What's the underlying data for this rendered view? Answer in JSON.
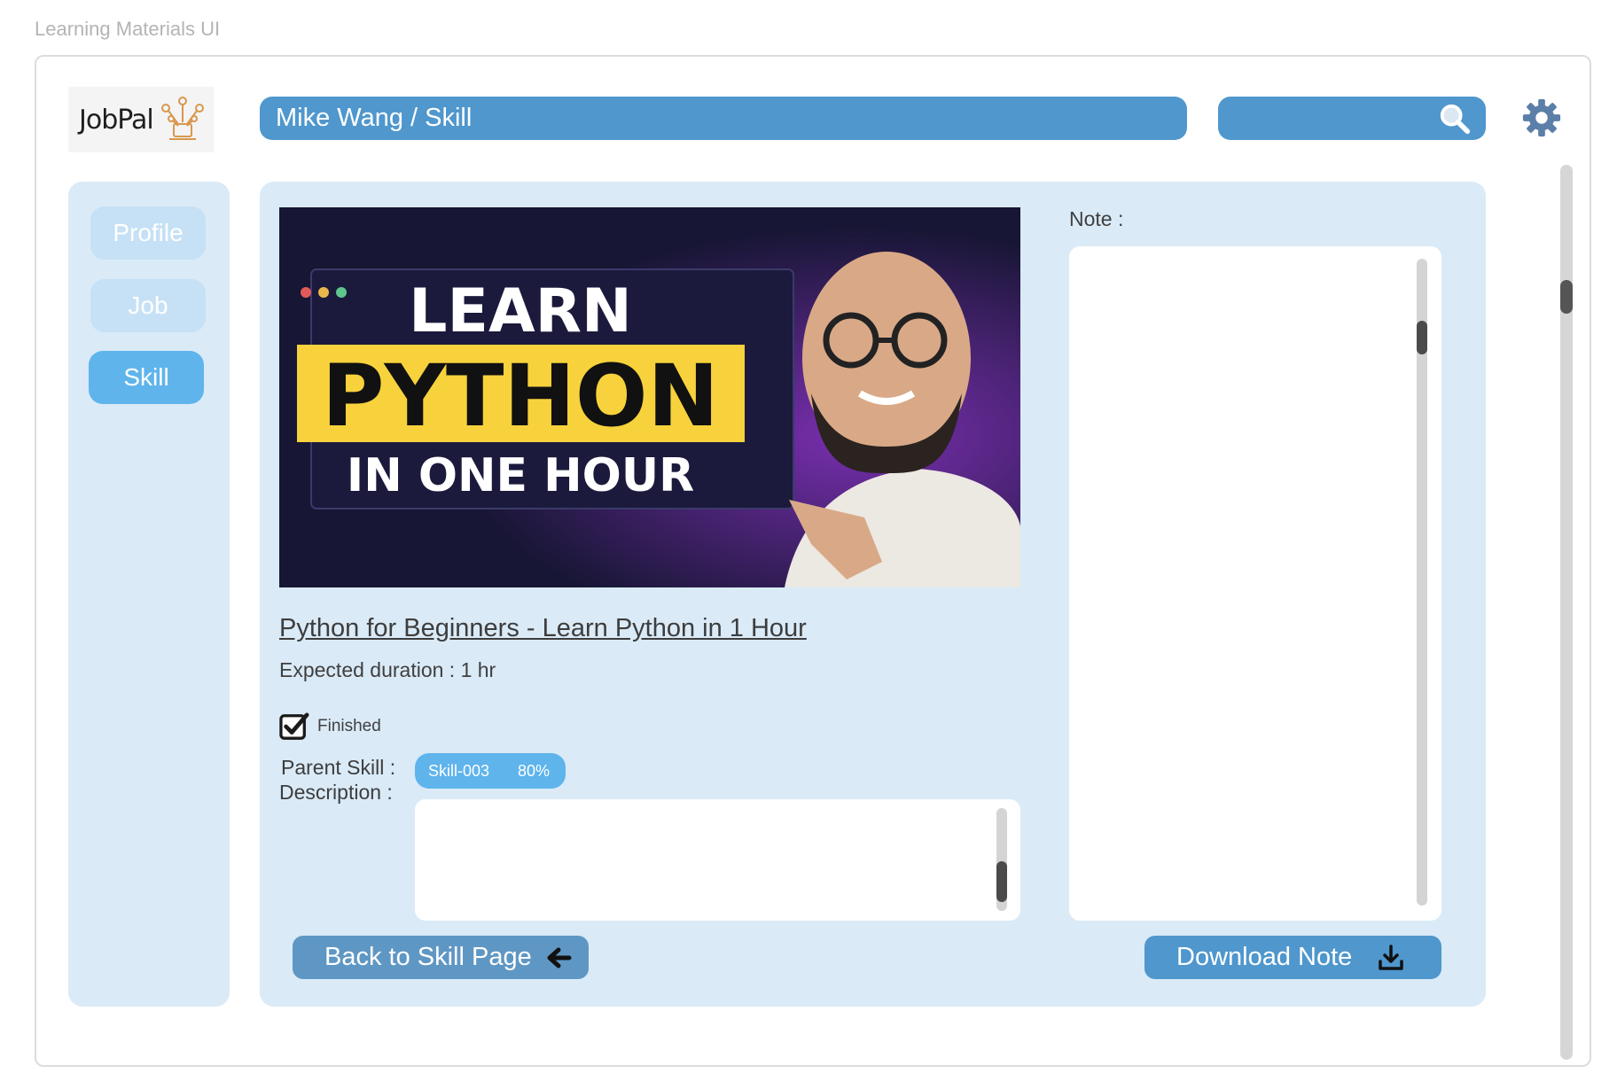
{
  "frame_title": "Learning Materials UI",
  "logo": {
    "text": "JobPal"
  },
  "header": {
    "breadcrumb": "Mike Wang / Skill",
    "search": {
      "value": "",
      "icon": "search-icon"
    },
    "settings_icon": "gear-icon"
  },
  "sidebar": {
    "items": [
      {
        "label": "Profile",
        "active": false
      },
      {
        "label": "Job",
        "active": false
      },
      {
        "label": "Skill",
        "active": true
      }
    ]
  },
  "video": {
    "thumbnail_lines": [
      "LEARN",
      "PYTHON",
      "IN ONE HOUR"
    ]
  },
  "course": {
    "title": "Python for Beginners - Learn Python in 1 Hour",
    "duration": "Expected duration : 1 hr",
    "finished_label": "Finished",
    "finished": true,
    "parent_skill_label": "Parent Skill :",
    "parent_skill": {
      "id": "Skill-003",
      "percent": "80%"
    },
    "description_label": "Description :",
    "description": ""
  },
  "note": {
    "label": "Note :",
    "content": ""
  },
  "buttons": {
    "back": "Back to Skill Page",
    "download": "Download Note"
  },
  "colors": {
    "primary": "#4f97cd",
    "active": "#5fb4ec",
    "panel": "#daeaf7",
    "inactive_nav": "#c6e1f5",
    "thumbnail_highlight": "#f7d23c"
  }
}
